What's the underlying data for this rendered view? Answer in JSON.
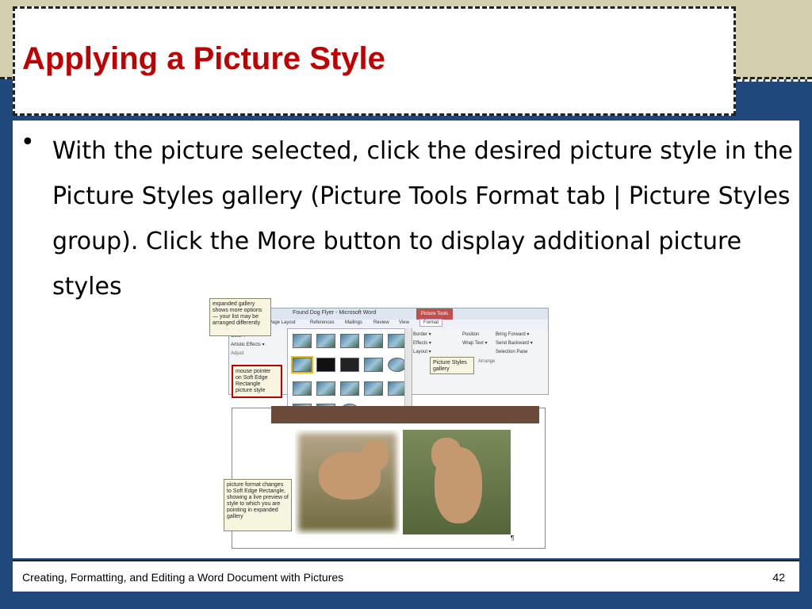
{
  "slide": {
    "title": "Applying a Picture Style",
    "bullet_marker": "•",
    "bullet_text": "With the picture selected, click the desired picture style in the Picture Styles gallery (Picture Tools Format tab | Picture Styles group). Click the More button to display additional picture styles",
    "footer_text": "Creating, Formatting, and Editing a Word Document with Pictures",
    "page_number": "42"
  },
  "screenshot": {
    "window_title": "Found Dog Flyer - Microsoft Word",
    "picture_tools_label": "Picture Tools",
    "tabs": [
      "Page Layout",
      "References",
      "Mailings",
      "Review",
      "View",
      "Format"
    ],
    "adjust_items": [
      "Color ▾",
      "Artistic Effects ▾"
    ],
    "adjust_group_label": "Adjust",
    "picture_border_items": [
      "Border ▾",
      "Effects ▾",
      "Layout ▾"
    ],
    "arrange_items": [
      "Position",
      "Wrap Text ▾",
      "Bring Forward ▾",
      "Send Backward ▾",
      "Selection Pane"
    ],
    "arrange_group_label": "Arrange",
    "callouts": {
      "expanded_gallery": "expanded gallery shows more options — your list may be arranged differently",
      "mouse_pointer": "mouse pointer on Soft Edge Rectangle picture style",
      "picture_styles_gallery": "Picture Styles gallery",
      "picture_format": "picture format changes to Soft Edge Rectangle, showing a live preview of style to which you are pointing in expanded gallery"
    },
    "pilcrow": "¶"
  },
  "colors": {
    "title_red": "#c00000",
    "background_blue": "#1f497d",
    "top_band": "#d4cfaf"
  }
}
